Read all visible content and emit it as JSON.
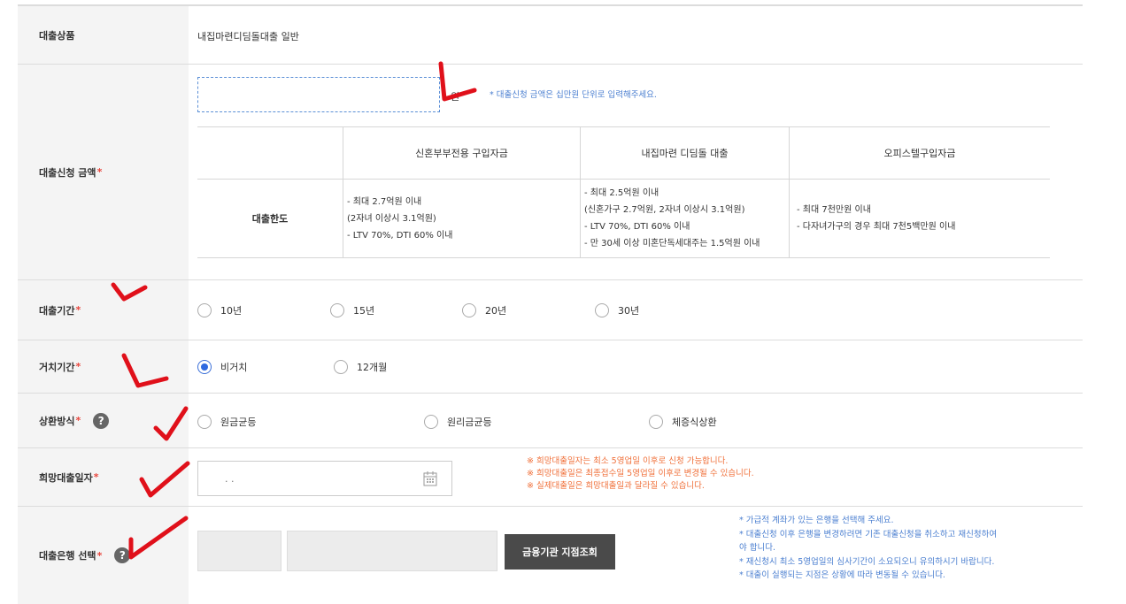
{
  "rows": {
    "product": {
      "label": "대출상품",
      "value": "내집마련디딤돌대출 일반"
    },
    "amount": {
      "label": "대출신청 금액",
      "unit": "원",
      "note": "* 대출신청 금액은 십만원 단위로 입력해주세요.",
      "table": {
        "row_header": "대출한도",
        "columns": [
          "신혼부부전용 구입자금",
          "내집마련 디딤돌 대출",
          "오피스텔구입자금"
        ],
        "cells": [
          [
            "- 최대 2.7억원 이내",
            "(2자녀 이상시 3.1억원)",
            "- LTV 70%, DTI 60% 이내"
          ],
          [
            "- 최대 2.5억원 이내",
            "(신혼가구 2.7억원, 2자녀 이상시 3.1억원)",
            "- LTV 70%, DTI 60% 이내",
            "- 만 30세 이상 미혼단독세대주는 1.5억원 이내"
          ],
          [
            "- 최대 7천만원 이내",
            "- 다자녀가구의 경우 최대 7천5백만원 이내"
          ]
        ]
      }
    },
    "period": {
      "label": "대출기간",
      "options": [
        "10년",
        "15년",
        "20년",
        "30년"
      ],
      "selected": null
    },
    "grace": {
      "label": "거치기간",
      "options": [
        "비거치",
        "12개월"
      ],
      "selected": "비거치"
    },
    "repay": {
      "label": "상환방식",
      "help_icon": "question-icon",
      "options": [
        "원금균등",
        "원리금균등",
        "체증식상환"
      ],
      "selected": null
    },
    "date": {
      "label": "희망대출일자",
      "value": ". .",
      "notes": [
        "※ 희망대출일자는 최소 5영업일 이후로 신청 가능합니다.",
        "※ 희망대출일은 최종접수일 5영업일 이후로 변경될 수 있습니다.",
        "※ 실제대출일은 희망대출일과 달라질 수 있습니다."
      ]
    },
    "bank": {
      "label": "대출은행 선택",
      "button": "금융기관 지점조회",
      "notes": [
        "* 가급적 계좌가 있는 은행을 선택해 주세요.",
        "* 대출신청 이후 은행을 변경하려면 기존 대출신청을 취소하고 재신청하여",
        "야 합니다.",
        "* 재신청시 최소 5영업일의 심사기간이 소요되오니 유의하시기 바랍니다.",
        "* 대출이 실행되는 지점은 상황에 따라 변동될 수 있습니다."
      ]
    }
  },
  "required_mark": "*",
  "colors": {
    "required": "#e8453c",
    "note_blue": "#4b7fd0",
    "note_red": "#f0703a",
    "annotation": "#e0101a"
  }
}
